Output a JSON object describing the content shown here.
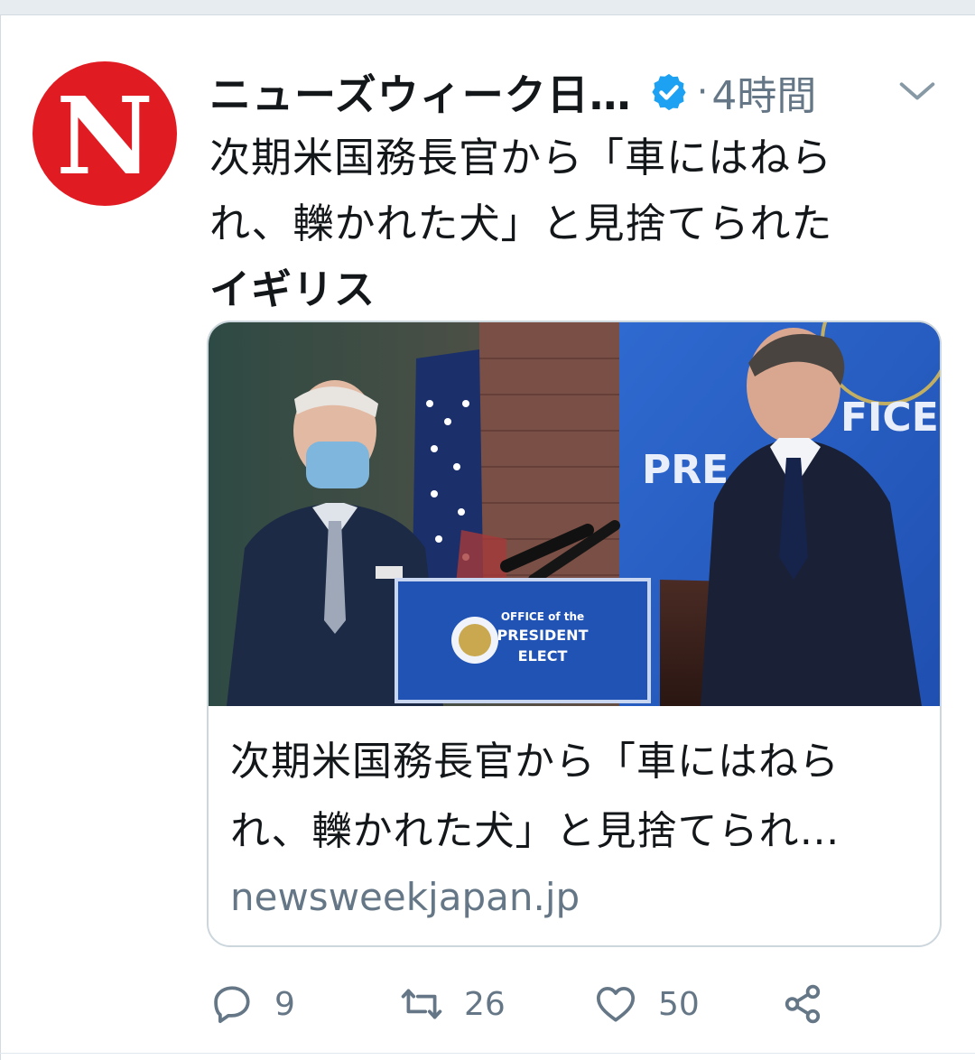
{
  "tweet": {
    "author_name": "ニューズウィーク日…",
    "separator": "·",
    "time": "4時間",
    "text_line1": "次期米国務長官から「車にはねら",
    "text_line2": "れ、轢かれた犬」と見捨てられた",
    "text_line3": "イギリス",
    "avatar_letter": "N",
    "brand_color": "#e11b22",
    "verified_color": "#1da1f2"
  },
  "card": {
    "title_line1": "次期米国務長官から「車にはねら",
    "title_line2": "れ、轢かれた犬」と見捨てられ…",
    "domain": "newsweekjapan.jp",
    "podium_sign": [
      "OFFICE of the",
      "PRESIDENT",
      "ELECT"
    ],
    "backdrop_text": [
      "FICE",
      "PRE"
    ]
  },
  "actions": {
    "reply_count": "9",
    "retweet_count": "26",
    "like_count": "50"
  },
  "icons": [
    "verified-badge-icon",
    "chevron-down-icon",
    "reply-icon",
    "retweet-icon",
    "like-icon",
    "share-icon"
  ]
}
